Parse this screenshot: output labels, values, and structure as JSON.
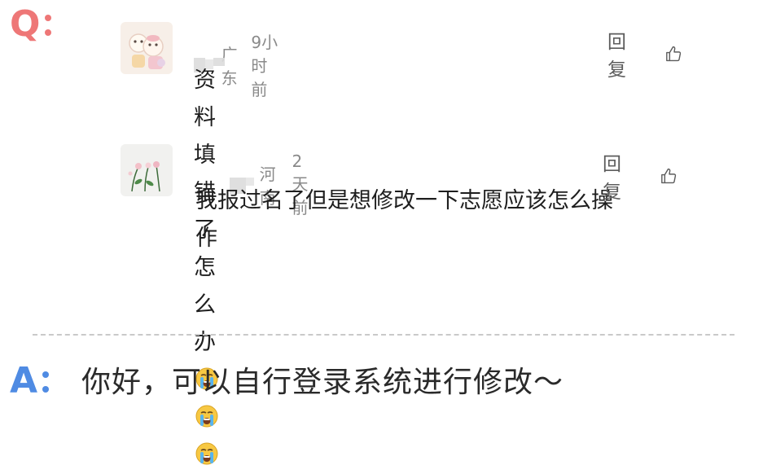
{
  "question": {
    "marker": "Q",
    "comments": [
      {
        "region": "广东",
        "time": "9小时前",
        "text": "资料填错了怎么办",
        "emoji": [
          "loudly-crying-face",
          "loudly-crying-face",
          "loudly-crying-face"
        ],
        "reply_label": "回复",
        "like_icon": "thumbs-up-icon"
      },
      {
        "region": "河南",
        "time": "2天前",
        "text_line1": "我报过名了但是想修改一下志愿应该怎么操",
        "text_line2": "作",
        "reply_label": "回复",
        "like_icon": "thumbs-up-icon"
      }
    ]
  },
  "answer": {
    "marker": "A",
    "text": "你好，可以自行登录系统进行修改～"
  },
  "colors": {
    "q_marker": "#ee7777",
    "a_marker": "#4f8be3",
    "meta_text": "#8a8a8a",
    "divider": "#c9c9c9"
  }
}
